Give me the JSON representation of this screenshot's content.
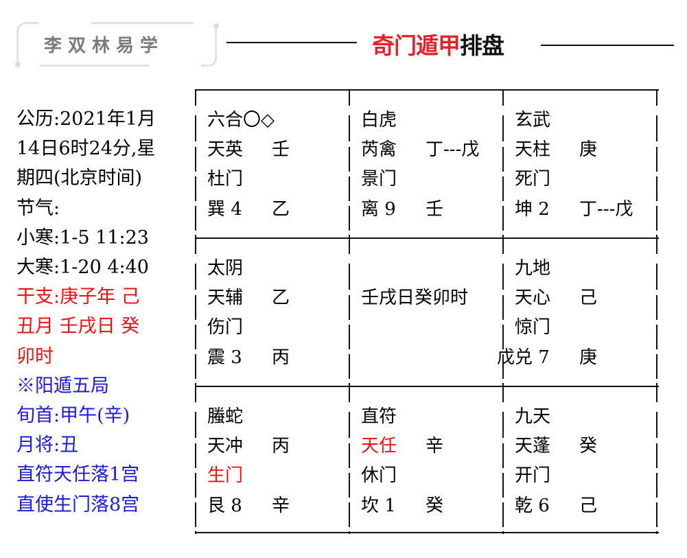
{
  "header": {
    "brand": "李双林易学",
    "title_red": "奇门遁甲",
    "title_black": "排盘"
  },
  "info": {
    "lines": [
      {
        "text": "公历:2021年1月",
        "color": "black"
      },
      {
        "text": "14日6时24分,星",
        "color": "black"
      },
      {
        "text": "期四(北京时间)",
        "color": "black"
      },
      {
        "text": "节气:",
        "color": "black"
      },
      {
        "text": "小寒:1-5 11:23",
        "color": "black"
      },
      {
        "text": "大寒:1-20 4:40",
        "color": "black"
      },
      {
        "text": "干支:庚子年 己",
        "color": "red"
      },
      {
        "text": "丑月 壬戌日 癸",
        "color": "red"
      },
      {
        "text": "卯时",
        "color": "red"
      },
      {
        "text": "※阳遁五局",
        "color": "blue"
      },
      {
        "text": "旬首:甲午(辛)",
        "color": "blue"
      },
      {
        "text": "月将:丑",
        "color": "blue"
      },
      {
        "text": "直符天任落1宫",
        "color": "blue"
      },
      {
        "text": "直使生门落8宫",
        "color": "blue"
      }
    ]
  },
  "colors": {
    "red": "#ee1111",
    "blue": "#1a1ad8",
    "title_red": "#e8202a",
    "brand_gray": "#7b7b7b"
  },
  "palaces": [
    {
      "id": "xun-4",
      "deity": "六合〇◇",
      "star": "天英",
      "star_stem": "壬",
      "door": "杜门",
      "trigram": "巽 4",
      "earth_stem": "乙",
      "star_red": false,
      "door_red": false
    },
    {
      "id": "li-9",
      "deity": "白虎",
      "star": "芮禽",
      "star_stem": "丁---戊",
      "door": "景门",
      "trigram": "离 9",
      "earth_stem": "壬",
      "star_red": false,
      "door_red": false
    },
    {
      "id": "kun-2",
      "deity": "玄武",
      "star": "天柱",
      "star_stem": "庚",
      "door": "死门",
      "trigram": "坤 2",
      "earth_stem": "丁---戊",
      "star_red": false,
      "door_red": false
    },
    {
      "id": "zhen-3",
      "deity": "太阴",
      "star": "天辅",
      "star_stem": "乙",
      "door": "伤门",
      "trigram": "震 3",
      "earth_stem": "丙",
      "star_red": false,
      "door_red": false
    },
    {
      "id": "center-5",
      "center_text": "壬戌日癸卯时",
      "center_stem": "戊"
    },
    {
      "id": "dui-7",
      "deity": "九地",
      "star": "天心",
      "star_stem": "己",
      "door": "惊门",
      "trigram": "兑 7",
      "earth_stem": "庚",
      "star_red": false,
      "door_red": false
    },
    {
      "id": "gen-8",
      "deity": "螣蛇",
      "star": "天冲",
      "star_stem": "丙",
      "door": "生门",
      "trigram": "艮 8",
      "earth_stem": "辛",
      "star_red": false,
      "door_red": true
    },
    {
      "id": "kan-1",
      "deity": "直符",
      "star": "天任",
      "star_stem": "辛",
      "door": "休门",
      "trigram": "坎 1",
      "earth_stem": "癸",
      "star_red": true,
      "door_red": false
    },
    {
      "id": "qian-6",
      "deity": "九天",
      "star": "天蓬",
      "star_stem": "癸",
      "door": "开门",
      "trigram": "乾 6",
      "earth_stem": "己",
      "star_red": false,
      "door_red": false
    }
  ]
}
